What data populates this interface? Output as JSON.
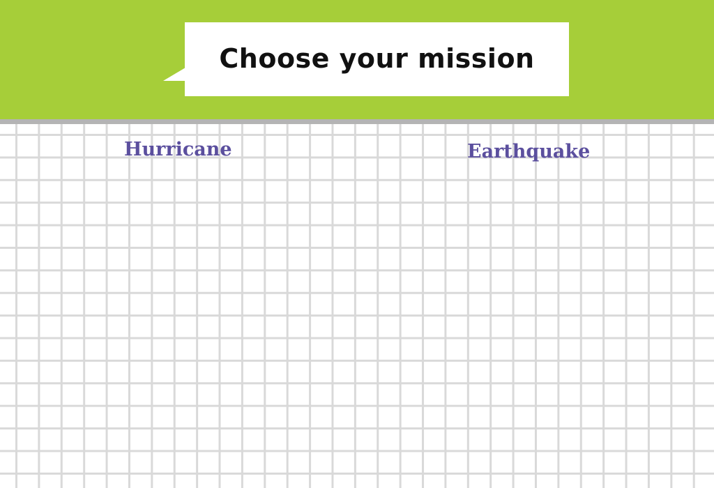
{
  "header": {
    "title": "Choose your mission"
  },
  "missions": [
    {
      "label": "Hurricane"
    },
    {
      "label": "Earthquake"
    }
  ],
  "colors": {
    "header_background": "#a6ce39",
    "mission_text": "#5b4f9e",
    "grid_line": "#d9d9d9"
  }
}
